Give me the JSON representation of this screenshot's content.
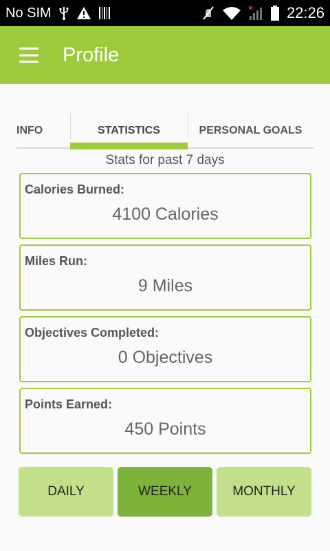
{
  "status_bar": {
    "carrier": "No SIM",
    "time": "22:26",
    "icons": [
      "usb-icon",
      "warning-icon",
      "barcode-icon",
      "mute-icon",
      "wifi-icon",
      "signal-icon",
      "battery-icon"
    ]
  },
  "app_bar": {
    "title": "Profile",
    "menu_icon": "hamburger-icon",
    "color": "#9dcb3c"
  },
  "tabs": [
    {
      "label": "INFO",
      "selected": false
    },
    {
      "label": "STATISTICS",
      "selected": true
    },
    {
      "label": "PERSONAL GOALS",
      "selected": false
    }
  ],
  "subtitle": "Stats for past 7 days",
  "stats": [
    {
      "label": "Calories Burned:",
      "value": "4100 Calories"
    },
    {
      "label": "Miles Run:",
      "value": "9 Miles"
    },
    {
      "label": "Objectives Completed:",
      "value": "0 Objectives"
    },
    {
      "label": "Points Earned:",
      "value": "450 Points"
    }
  ],
  "range_buttons": [
    {
      "label": "DAILY",
      "selected": false
    },
    {
      "label": "WEEKLY",
      "selected": true
    },
    {
      "label": "MONTHLY",
      "selected": false
    }
  ],
  "colors": {
    "accent": "#9dcb3c",
    "button_selected": "#7db33a",
    "button_default": "#c2e08a"
  }
}
